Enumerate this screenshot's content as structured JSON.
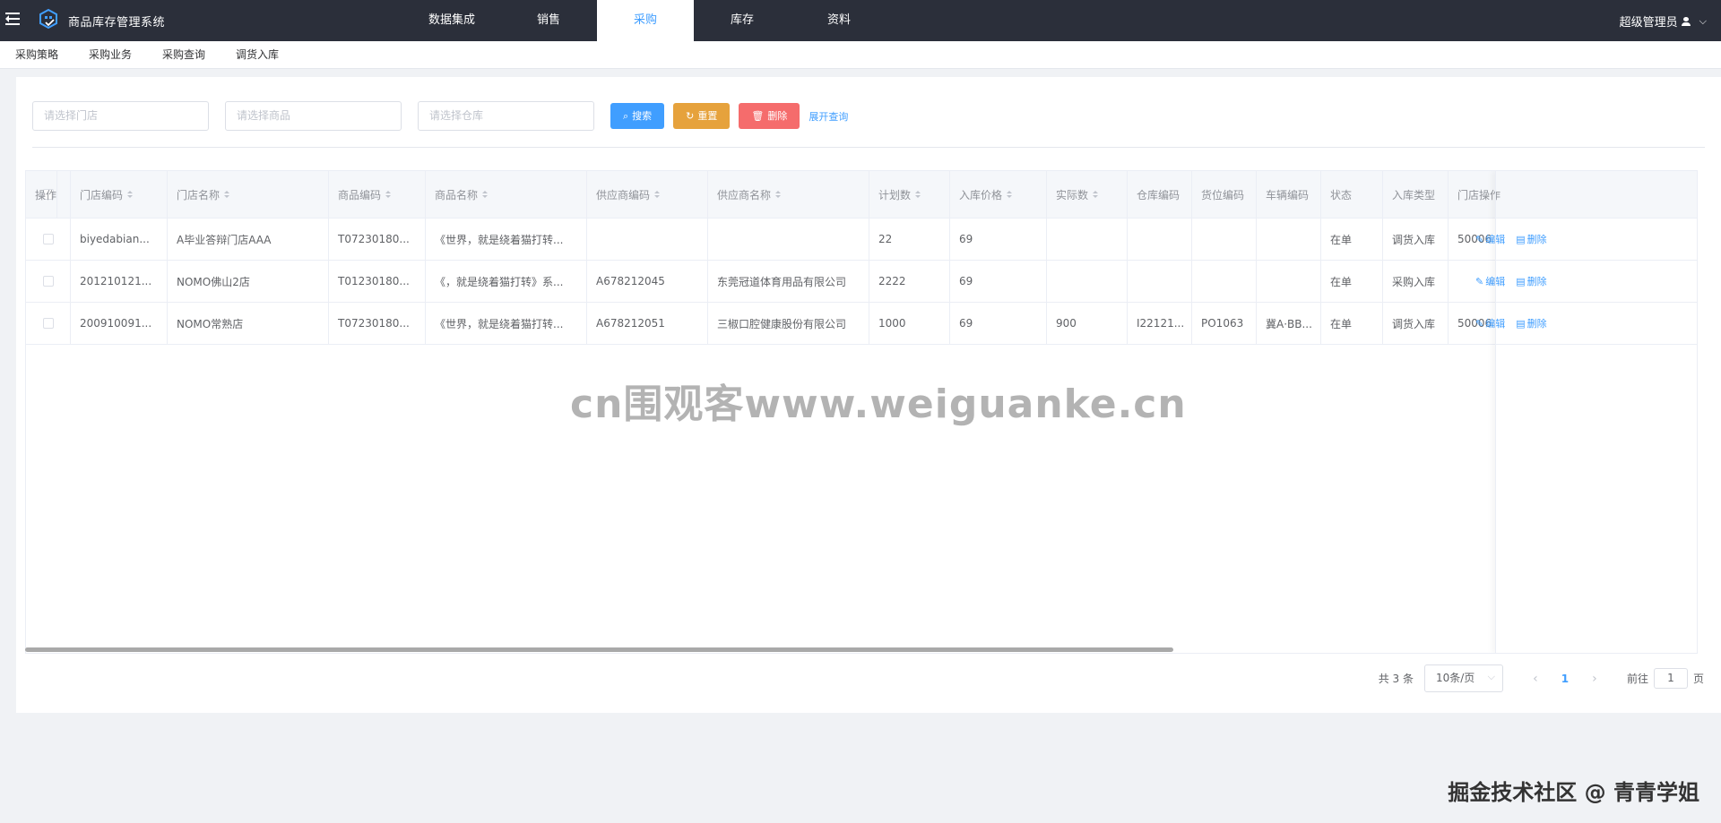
{
  "app_title": "商品库存管理系统",
  "top_tabs": [
    {
      "label": "数据集成",
      "active": false
    },
    {
      "label": "销售",
      "active": false
    },
    {
      "label": "采购",
      "active": true
    },
    {
      "label": "库存",
      "active": false
    },
    {
      "label": "资料",
      "active": false
    }
  ],
  "user": {
    "name": "超级管理员"
  },
  "sub_nav": [
    "采购策略",
    "采购业务",
    "采购查询",
    "调货入库"
  ],
  "filter": {
    "store_placeholder": "请选择门店",
    "product_placeholder": "请选择商品",
    "warehouse_placeholder": "请选择仓库",
    "search_label": "搜索",
    "reset_label": "重置",
    "delete_label": "删除",
    "expand_label": "展开查询"
  },
  "table": {
    "columns": [
      "门店编码",
      "门店名称",
      "商品编码",
      "商品名称",
      "供应商编码",
      "供应商名称",
      "计划数",
      "入库价格",
      "实际数",
      "仓库编码",
      "货位编码",
      "车辆编码",
      "状态",
      "入库类型",
      "门店操作",
      "操作"
    ],
    "rows": [
      [
        "biyedabian...",
        "A毕业答辩门店AAA",
        "T07230180...",
        "《世界，就是绕着猫打转...",
        "",
        "",
        "22",
        "69",
        "",
        "",
        "",
        "",
        "在单",
        "调货入库",
        "50006"
      ],
      [
        "201210121...",
        "NOMO佛山2店",
        "T01230180...",
        "《，就是绕着猫打转》系...",
        "A678212045",
        "东莞冠道体育用品有限公司",
        "2222",
        "69",
        "",
        "",
        "",
        "",
        "在单",
        "采购入库",
        ""
      ],
      [
        "200910091...",
        "NOMO常熟店",
        "T07230180...",
        "《世界，就是绕着猫打转...",
        "A678212051",
        "三椒口腔健康股份有限公司",
        "1000",
        "69",
        "900",
        "I22121...",
        "PO1063",
        "冀A·BB...",
        "在单",
        "调货入库",
        "50006"
      ]
    ],
    "op_edit": "编辑",
    "op_delete": "删除"
  },
  "watermark": "cn围观客www.weiguanke.cn",
  "pagination": {
    "total": "共 3 条",
    "page_size": "10条/页",
    "current_page": "1",
    "goto_label": "前往",
    "goto_value": "1",
    "page_suffix": "页"
  },
  "footer_mark": "掘金技术社区 @ 青青学姐"
}
